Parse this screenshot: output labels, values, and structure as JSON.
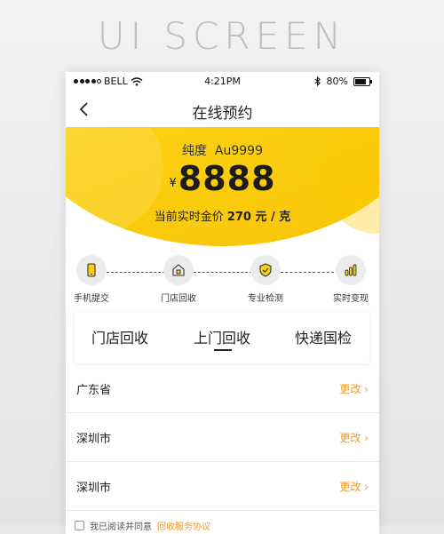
{
  "background_title": "UI SCREEN",
  "status_bar": {
    "carrier": "BELL",
    "time": "4:21PM",
    "battery": "80%",
    "battery_level": 0.8
  },
  "nav": {
    "title": "在线预约"
  },
  "hero": {
    "purity_label": "纯度",
    "purity_value": "Au9999",
    "currency": "¥",
    "price": "8888",
    "gold_price_label": "当前实时金价",
    "gold_price_value": "270 元 / 克"
  },
  "steps": [
    {
      "label": "手机提交",
      "icon": "phone-icon"
    },
    {
      "label": "门店回收",
      "icon": "store-icon"
    },
    {
      "label": "专业检测",
      "icon": "shield-check-icon"
    },
    {
      "label": "实时变现",
      "icon": "bar-chart-icon"
    }
  ],
  "tabs": [
    {
      "label": "门店回收",
      "active": false
    },
    {
      "label": "上门回收",
      "active": true
    },
    {
      "label": "快递国检",
      "active": false
    }
  ],
  "rows": [
    {
      "label": "广东省",
      "action": "更改 ›"
    },
    {
      "label": "深圳市",
      "action": "更改 ›"
    },
    {
      "label": "深圳市",
      "action": "更改 ›"
    }
  ],
  "agreement": {
    "text": "我已阅读并同意",
    "link": "回收服务协议"
  },
  "colors": {
    "accent": "#fcd012",
    "link": "#f29a2e"
  }
}
